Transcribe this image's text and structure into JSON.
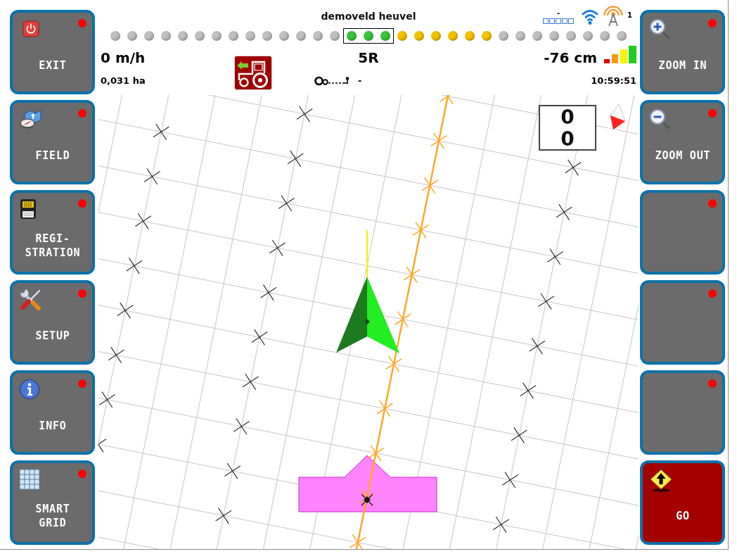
{
  "header": {
    "field_name": "demoveld heuvel",
    "correction_status": "-",
    "antenna_count": "1"
  },
  "lightbar": [
    {
      "color": "#c0c0c0"
    },
    {
      "color": "#c0c0c0"
    },
    {
      "color": "#c0c0c0"
    },
    {
      "color": "#c0c0c0"
    },
    {
      "color": "#c0c0c0"
    },
    {
      "color": "#c0c0c0"
    },
    {
      "color": "#c0c0c0"
    },
    {
      "color": "#c0c0c0"
    },
    {
      "color": "#c0c0c0"
    },
    {
      "color": "#c0c0c0"
    },
    {
      "color": "#c0c0c0"
    },
    {
      "color": "#c0c0c0"
    },
    {
      "color": "#c0c0c0"
    },
    {
      "color": "#c0c0c0"
    },
    {
      "color": "#3ac43a"
    },
    {
      "color": "#3ac43a"
    },
    {
      "color": "#3ac43a"
    },
    {
      "color": "#f2c200"
    },
    {
      "color": "#f2c200"
    },
    {
      "color": "#f2c200"
    },
    {
      "color": "#f2c200"
    },
    {
      "color": "#f2c200"
    },
    {
      "color": "#f2c200"
    },
    {
      "color": "#c0c0c0"
    },
    {
      "color": "#c0c0c0"
    },
    {
      "color": "#c0c0c0"
    },
    {
      "color": "#c0c0c0"
    },
    {
      "color": "#c0c0c0"
    },
    {
      "color": "#c0c0c0"
    },
    {
      "color": "#c0c0c0"
    },
    {
      "color": "#c0c0c0"
    }
  ],
  "readouts": {
    "speed": "0 m/h",
    "area": "0,031 ha",
    "guidance_row": "5R",
    "implement_status": "-",
    "offset": "-76 cm",
    "time": "10:59:51"
  },
  "left_buttons": [
    {
      "kind": "exit",
      "label": "EXIT",
      "indicator": true,
      "active": false
    },
    {
      "kind": "field",
      "label": "FIELD",
      "indicator": true,
      "active": false
    },
    {
      "kind": "registration",
      "label": "REGI-\nSTRATION",
      "indicator": true,
      "active": false
    },
    {
      "kind": "setup",
      "label": "SETUP",
      "indicator": true,
      "active": false
    },
    {
      "kind": "info",
      "label": "INFO",
      "indicator": true,
      "active": false
    },
    {
      "kind": "grid",
      "label": "SMART\nGRID",
      "indicator": true,
      "active": false
    }
  ],
  "right_buttons": [
    {
      "kind": "zoom_in",
      "label": "ZOOM IN",
      "indicator": true,
      "active": false
    },
    {
      "kind": "zoom_out",
      "label": "ZOOM OUT",
      "indicator": true,
      "active": false
    },
    {
      "kind": "blank",
      "indicator": true,
      "active": false
    },
    {
      "kind": "blank",
      "indicator": true,
      "active": false
    },
    {
      "kind": "blank",
      "indicator": true,
      "active": false
    },
    {
      "kind": "go",
      "label": "GO",
      "indicator": false,
      "active": true
    }
  ],
  "map": {
    "counter": [
      "0",
      "0"
    ]
  }
}
